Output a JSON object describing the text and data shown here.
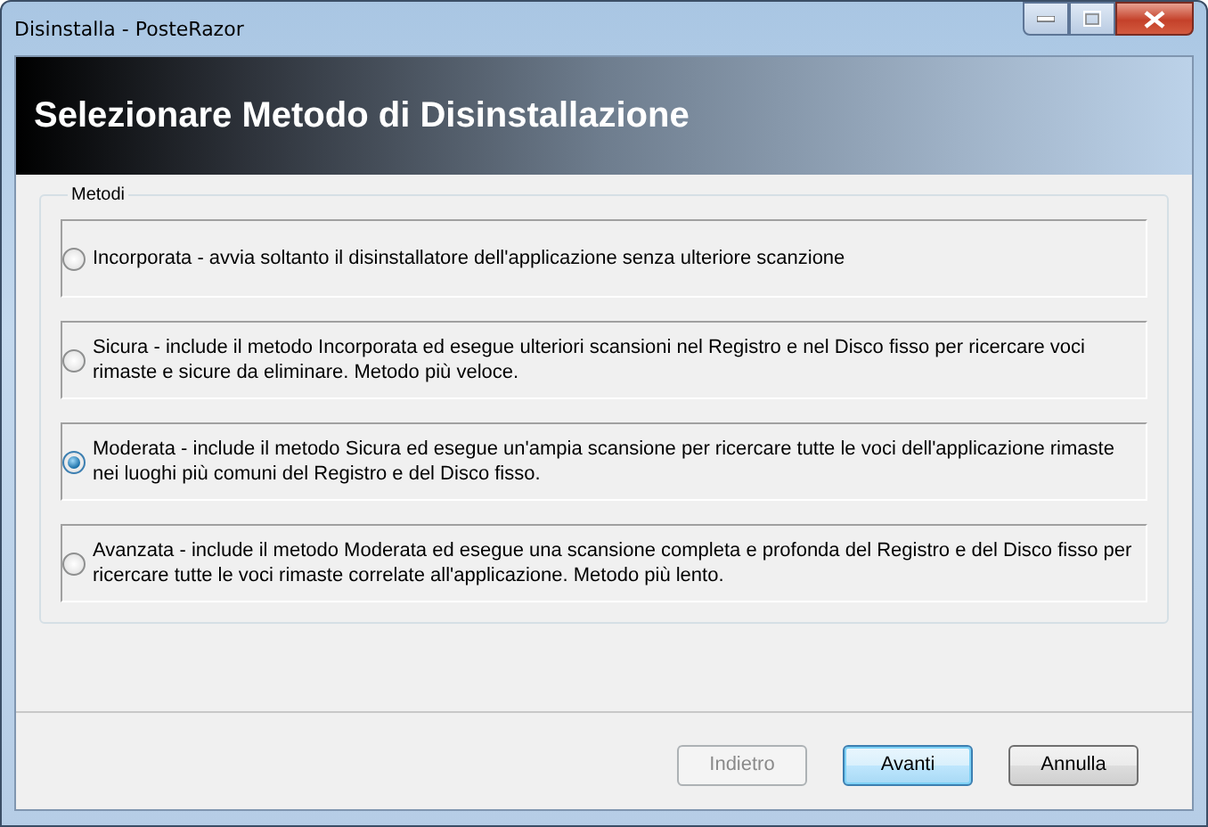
{
  "window": {
    "title": "Disinstalla - PosteRazor"
  },
  "header": {
    "title": "Selezionare Metodo di Disinstallazione"
  },
  "group": {
    "label": "Metodi"
  },
  "options": [
    {
      "text": "Incorporata - avvia soltanto il disinstallatore dell'applicazione senza ulteriore scanzione",
      "selected": false
    },
    {
      "text": "Sicura - include il metodo Incorporata ed esegue ulteriori scansioni nel Registro e nel Disco fisso per ricercare  voci rimaste  e sicure da eliminare. Metodo più veloce.",
      "selected": false
    },
    {
      "text": "Moderata - include il metodo Sicura ed esegue un'ampia scansione per ricercare tutte le voci dell'applicazione rimaste nei luoghi più comuni del Registro e del Disco fisso.",
      "selected": true
    },
    {
      "text": "Avanzata - include il metodo Moderata ed esegue una scansione completa e profonda del Registro e del Disco fisso per ricercare tutte le voci rimaste correlate all'applicazione. Metodo più lento.",
      "selected": false
    }
  ],
  "buttons": [
    {
      "label": "Indietro",
      "disabled": true,
      "default": false
    },
    {
      "label": "Avanti",
      "disabled": false,
      "default": true
    },
    {
      "label": "Annulla",
      "disabled": false,
      "default": false
    }
  ]
}
